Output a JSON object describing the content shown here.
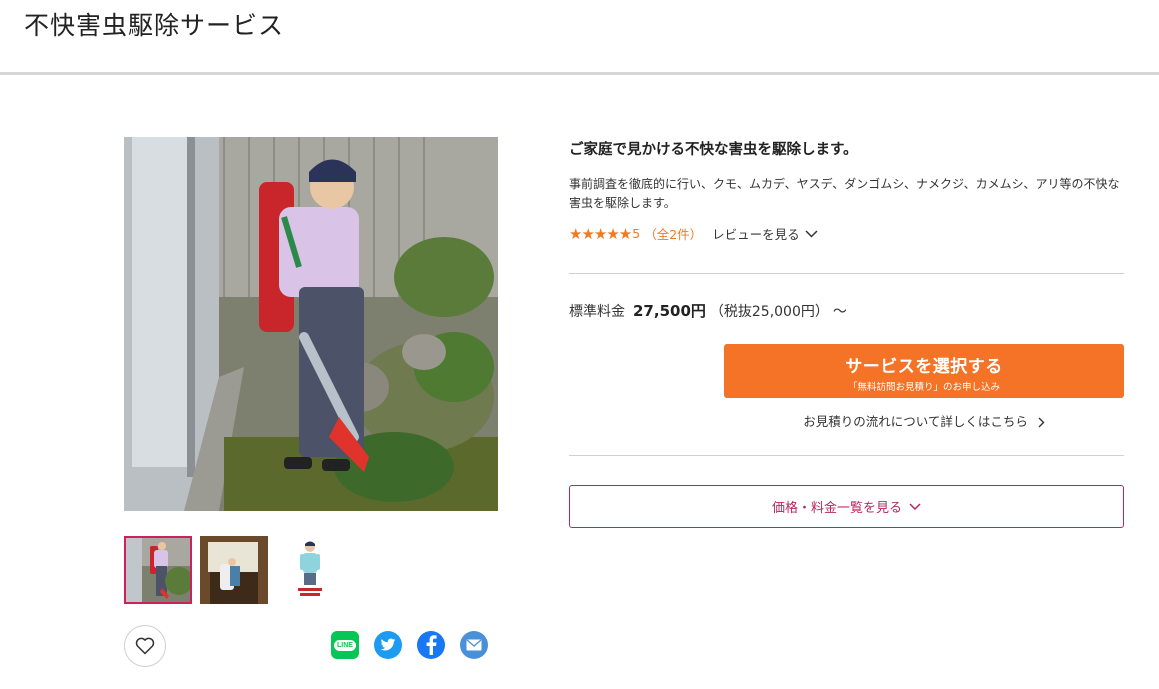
{
  "page": {
    "title": "不快害虫駆除サービス"
  },
  "gallery": {
    "thumbnail_count": 3,
    "selected_thumbnail": 0
  },
  "service": {
    "headline": "ご家庭で見かける不快な害虫を駆除します。",
    "description": "事前調査を徹底的に行い、クモ、ムカデ、ヤスデ、ダンゴムシ、ナメクジ、カメムシ、アリ等の不快な害虫を駆除します。",
    "rating": {
      "stars_text": "★★★★★",
      "value": "5",
      "count": "（全2件）",
      "review_link": "レビューを見る"
    },
    "price": {
      "label": "標準料金",
      "value": "27,500円",
      "tax_note": "（税抜25,000円）",
      "suffix": "～"
    },
    "cta": {
      "main": "サービスを選択する",
      "sub": "「無料訪問お見積り」のお申し込み"
    },
    "flow_link": "お見積りの流れについて詳しくはこちら",
    "price_list_button": "価格・料金一覧を見る"
  },
  "share": {
    "line_label": "LINE",
    "icons": [
      "line-icon",
      "twitter-icon",
      "facebook-icon",
      "mail-icon"
    ]
  },
  "colors": {
    "accent_orange": "#f47326",
    "star_orange": "#f07a23",
    "brand_magenta": "#b8265f",
    "line_green": "#06c755",
    "twitter_blue": "#1d9bf0",
    "facebook_blue": "#1877f2",
    "mail_blue": "#4a90d9"
  }
}
